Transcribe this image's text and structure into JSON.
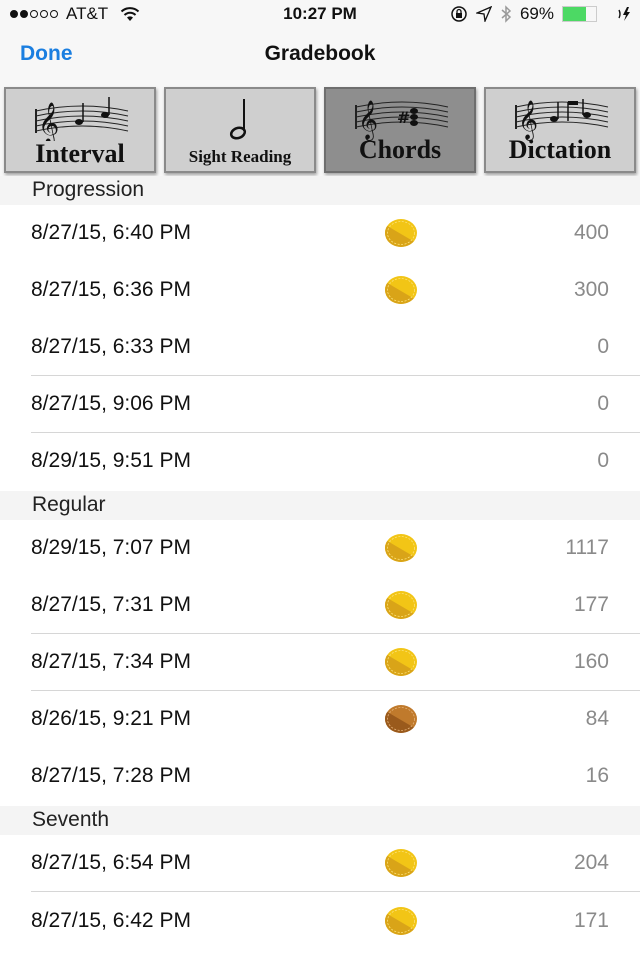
{
  "status_bar": {
    "signal_bars_filled": 2,
    "signal_bars_total": 5,
    "carrier": "AT&T",
    "time": "10:27 PM",
    "battery_percent_label": "69%",
    "battery_level": 0.69,
    "icons": [
      "wifi-icon",
      "orientation-lock-icon",
      "location-icon",
      "bluetooth-icon",
      "battery-icon",
      "charging-icon"
    ]
  },
  "nav": {
    "done_label": "Done",
    "title": "Gradebook"
  },
  "tabs": [
    {
      "label": "Interval",
      "icon": "staff-notes-icon",
      "selected": false
    },
    {
      "label": "Sight Reading",
      "icon": "half-note-icon",
      "selected": false
    },
    {
      "label": "Chords",
      "icon": "staff-chord-icon",
      "selected": true
    },
    {
      "label": "Dictation",
      "icon": "staff-notes-icon",
      "selected": false
    }
  ],
  "colors": {
    "accent": "#1a7ee0",
    "coin_gold": "#f2c516",
    "coin_bronze": "#c07a2c",
    "battery": "#4cd964"
  },
  "sections": [
    {
      "title": "Progression",
      "rows": [
        {
          "date": "8/27/15, 6:40 PM",
          "medal": "gold",
          "score": "400"
        },
        {
          "date": "8/27/15, 6:36 PM",
          "medal": "gold",
          "score": "300"
        },
        {
          "date": "8/27/15, 6:33 PM",
          "medal": null,
          "score": "0"
        },
        {
          "date": "8/27/15, 9:06 PM",
          "medal": null,
          "score": "0"
        },
        {
          "date": "8/29/15, 9:51 PM",
          "medal": null,
          "score": "0"
        }
      ]
    },
    {
      "title": "Regular",
      "rows": [
        {
          "date": "8/29/15, 7:07 PM",
          "medal": "gold",
          "score": "1117"
        },
        {
          "date": "8/27/15, 7:31 PM",
          "medal": "gold",
          "score": "177"
        },
        {
          "date": "8/27/15, 7:34 PM",
          "medal": "gold",
          "score": "160"
        },
        {
          "date": "8/26/15, 9:21 PM",
          "medal": "bronze",
          "score": "84"
        },
        {
          "date": "8/27/15, 7:28 PM",
          "medal": null,
          "score": "16"
        }
      ]
    },
    {
      "title": "Seventh",
      "rows": [
        {
          "date": "8/27/15, 6:54 PM",
          "medal": "gold",
          "score": "204"
        },
        {
          "date": "8/27/15, 6:42 PM",
          "medal": "gold",
          "score": "171"
        }
      ]
    }
  ]
}
